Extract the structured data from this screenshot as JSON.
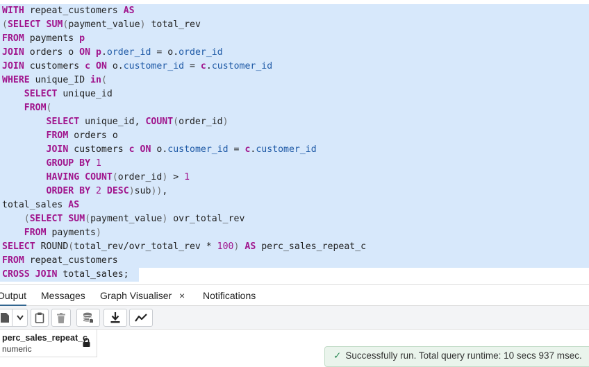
{
  "editor": {
    "selection_color": "#d7e8fb",
    "lines": [
      [
        [
          "kw",
          "WITH"
        ],
        [
          "t",
          " repeat_customers "
        ],
        [
          "kw",
          "AS"
        ]
      ],
      [
        [
          "p",
          "("
        ],
        [
          "kw",
          "SELECT"
        ],
        [
          "t",
          " "
        ],
        [
          "kw",
          "SUM"
        ],
        [
          "p",
          "("
        ],
        [
          "t",
          "payment_value"
        ],
        [
          "p",
          ")"
        ],
        [
          "t",
          " total_rev"
        ]
      ],
      [
        [
          "kw",
          "FROM"
        ],
        [
          "t",
          " payments "
        ],
        [
          "kw",
          "p"
        ]
      ],
      [
        [
          "kw",
          "JOIN"
        ],
        [
          "t",
          " orders o "
        ],
        [
          "kw",
          "ON"
        ],
        [
          "t",
          " "
        ],
        [
          "kw",
          "p"
        ],
        [
          "t",
          "."
        ],
        [
          "c",
          "order_id"
        ],
        [
          "t",
          " = o."
        ],
        [
          "c",
          "order_id"
        ]
      ],
      [
        [
          "kw",
          "JOIN"
        ],
        [
          "t",
          " customers "
        ],
        [
          "kw",
          "c"
        ],
        [
          "t",
          " "
        ],
        [
          "kw",
          "ON"
        ],
        [
          "t",
          " o."
        ],
        [
          "c",
          "customer_id"
        ],
        [
          "t",
          " = "
        ],
        [
          "kw",
          "c"
        ],
        [
          "t",
          "."
        ],
        [
          "c",
          "customer_id"
        ]
      ],
      [
        [
          "kw",
          "WHERE"
        ],
        [
          "t",
          " unique_ID "
        ],
        [
          "kw",
          "in"
        ],
        [
          "p",
          "("
        ]
      ],
      [
        [
          "t",
          "    "
        ],
        [
          "kw",
          "SELECT"
        ],
        [
          "t",
          " unique_id"
        ]
      ],
      [
        [
          "t",
          "    "
        ],
        [
          "kw",
          "FROM"
        ],
        [
          "p",
          "("
        ]
      ],
      [
        [
          "t",
          "        "
        ],
        [
          "kw",
          "SELECT"
        ],
        [
          "t",
          " unique_id, "
        ],
        [
          "kw",
          "COUNT"
        ],
        [
          "p",
          "("
        ],
        [
          "t",
          "order_id"
        ],
        [
          "p",
          ")"
        ]
      ],
      [
        [
          "t",
          "        "
        ],
        [
          "kw",
          "FROM"
        ],
        [
          "t",
          " orders o"
        ]
      ],
      [
        [
          "t",
          "        "
        ],
        [
          "kw",
          "JOIN"
        ],
        [
          "t",
          " customers "
        ],
        [
          "kw",
          "c"
        ],
        [
          "t",
          " "
        ],
        [
          "kw",
          "ON"
        ],
        [
          "t",
          " o."
        ],
        [
          "c",
          "customer_id"
        ],
        [
          "t",
          " = "
        ],
        [
          "kw",
          "c"
        ],
        [
          "t",
          "."
        ],
        [
          "c",
          "customer_id"
        ]
      ],
      [
        [
          "t",
          "        "
        ],
        [
          "kw",
          "GROUP BY"
        ],
        [
          "t",
          " "
        ],
        [
          "n",
          "1"
        ]
      ],
      [
        [
          "t",
          "        "
        ],
        [
          "kw",
          "HAVING"
        ],
        [
          "t",
          " "
        ],
        [
          "kw",
          "COUNT"
        ],
        [
          "p",
          "("
        ],
        [
          "t",
          "order_id"
        ],
        [
          "p",
          ")"
        ],
        [
          "t",
          " > "
        ],
        [
          "n",
          "1"
        ]
      ],
      [
        [
          "t",
          "        "
        ],
        [
          "kw",
          "ORDER BY"
        ],
        [
          "t",
          " "
        ],
        [
          "n",
          "2"
        ],
        [
          "t",
          " "
        ],
        [
          "kw",
          "DESC"
        ],
        [
          "p",
          ")"
        ],
        [
          "t",
          "sub"
        ],
        [
          "p",
          "))"
        ],
        [
          "t",
          ","
        ]
      ],
      [
        [
          "t",
          "total_sales "
        ],
        [
          "kw",
          "AS"
        ]
      ],
      [
        [
          "t",
          "    "
        ],
        [
          "p",
          "("
        ],
        [
          "kw",
          "SELECT"
        ],
        [
          "t",
          " "
        ],
        [
          "kw",
          "SUM"
        ],
        [
          "p",
          "("
        ],
        [
          "t",
          "payment_value"
        ],
        [
          "p",
          ")"
        ],
        [
          "t",
          " ovr_total_rev"
        ]
      ],
      [
        [
          "t",
          "    "
        ],
        [
          "kw",
          "FROM"
        ],
        [
          "t",
          " payments"
        ],
        [
          "p",
          ")"
        ]
      ],
      [
        [
          "kw",
          "SELECT"
        ],
        [
          "t",
          " ROUND"
        ],
        [
          "p",
          "("
        ],
        [
          "t",
          "total_rev/ovr_total_rev * "
        ],
        [
          "n",
          "100"
        ],
        [
          "p",
          ")"
        ],
        [
          "t",
          " "
        ],
        [
          "kw",
          "AS"
        ],
        [
          "t",
          " perc_sales_repeat_c"
        ]
      ],
      [
        [
          "kw",
          "FROM"
        ],
        [
          "t",
          " repeat_customers"
        ]
      ],
      [
        [
          "kw",
          "CROSS JOIN"
        ],
        [
          "t",
          " total_sales;"
        ]
      ]
    ]
  },
  "tabs": {
    "output": "Output",
    "messages": "Messages",
    "graph_visualiser": "Graph Visualiser",
    "graph_close": "×",
    "notifications": "Notifications",
    "active": "output",
    "accent": "#326690"
  },
  "toolbar": {
    "icons": [
      "add-row-icon",
      "dropdown-chevron-icon",
      "paste-icon",
      "delete-icon",
      "save-data-icon",
      "download-icon",
      "graph-icon"
    ]
  },
  "results": {
    "column_name": "perc_sales_repeat_c",
    "column_type": "numeric",
    "column_icon": "lock-icon"
  },
  "toast": {
    "message": "Successfully run. Total query runtime: 10 secs 937 msec.",
    "check": "✓",
    "color": "#2e8b57"
  }
}
